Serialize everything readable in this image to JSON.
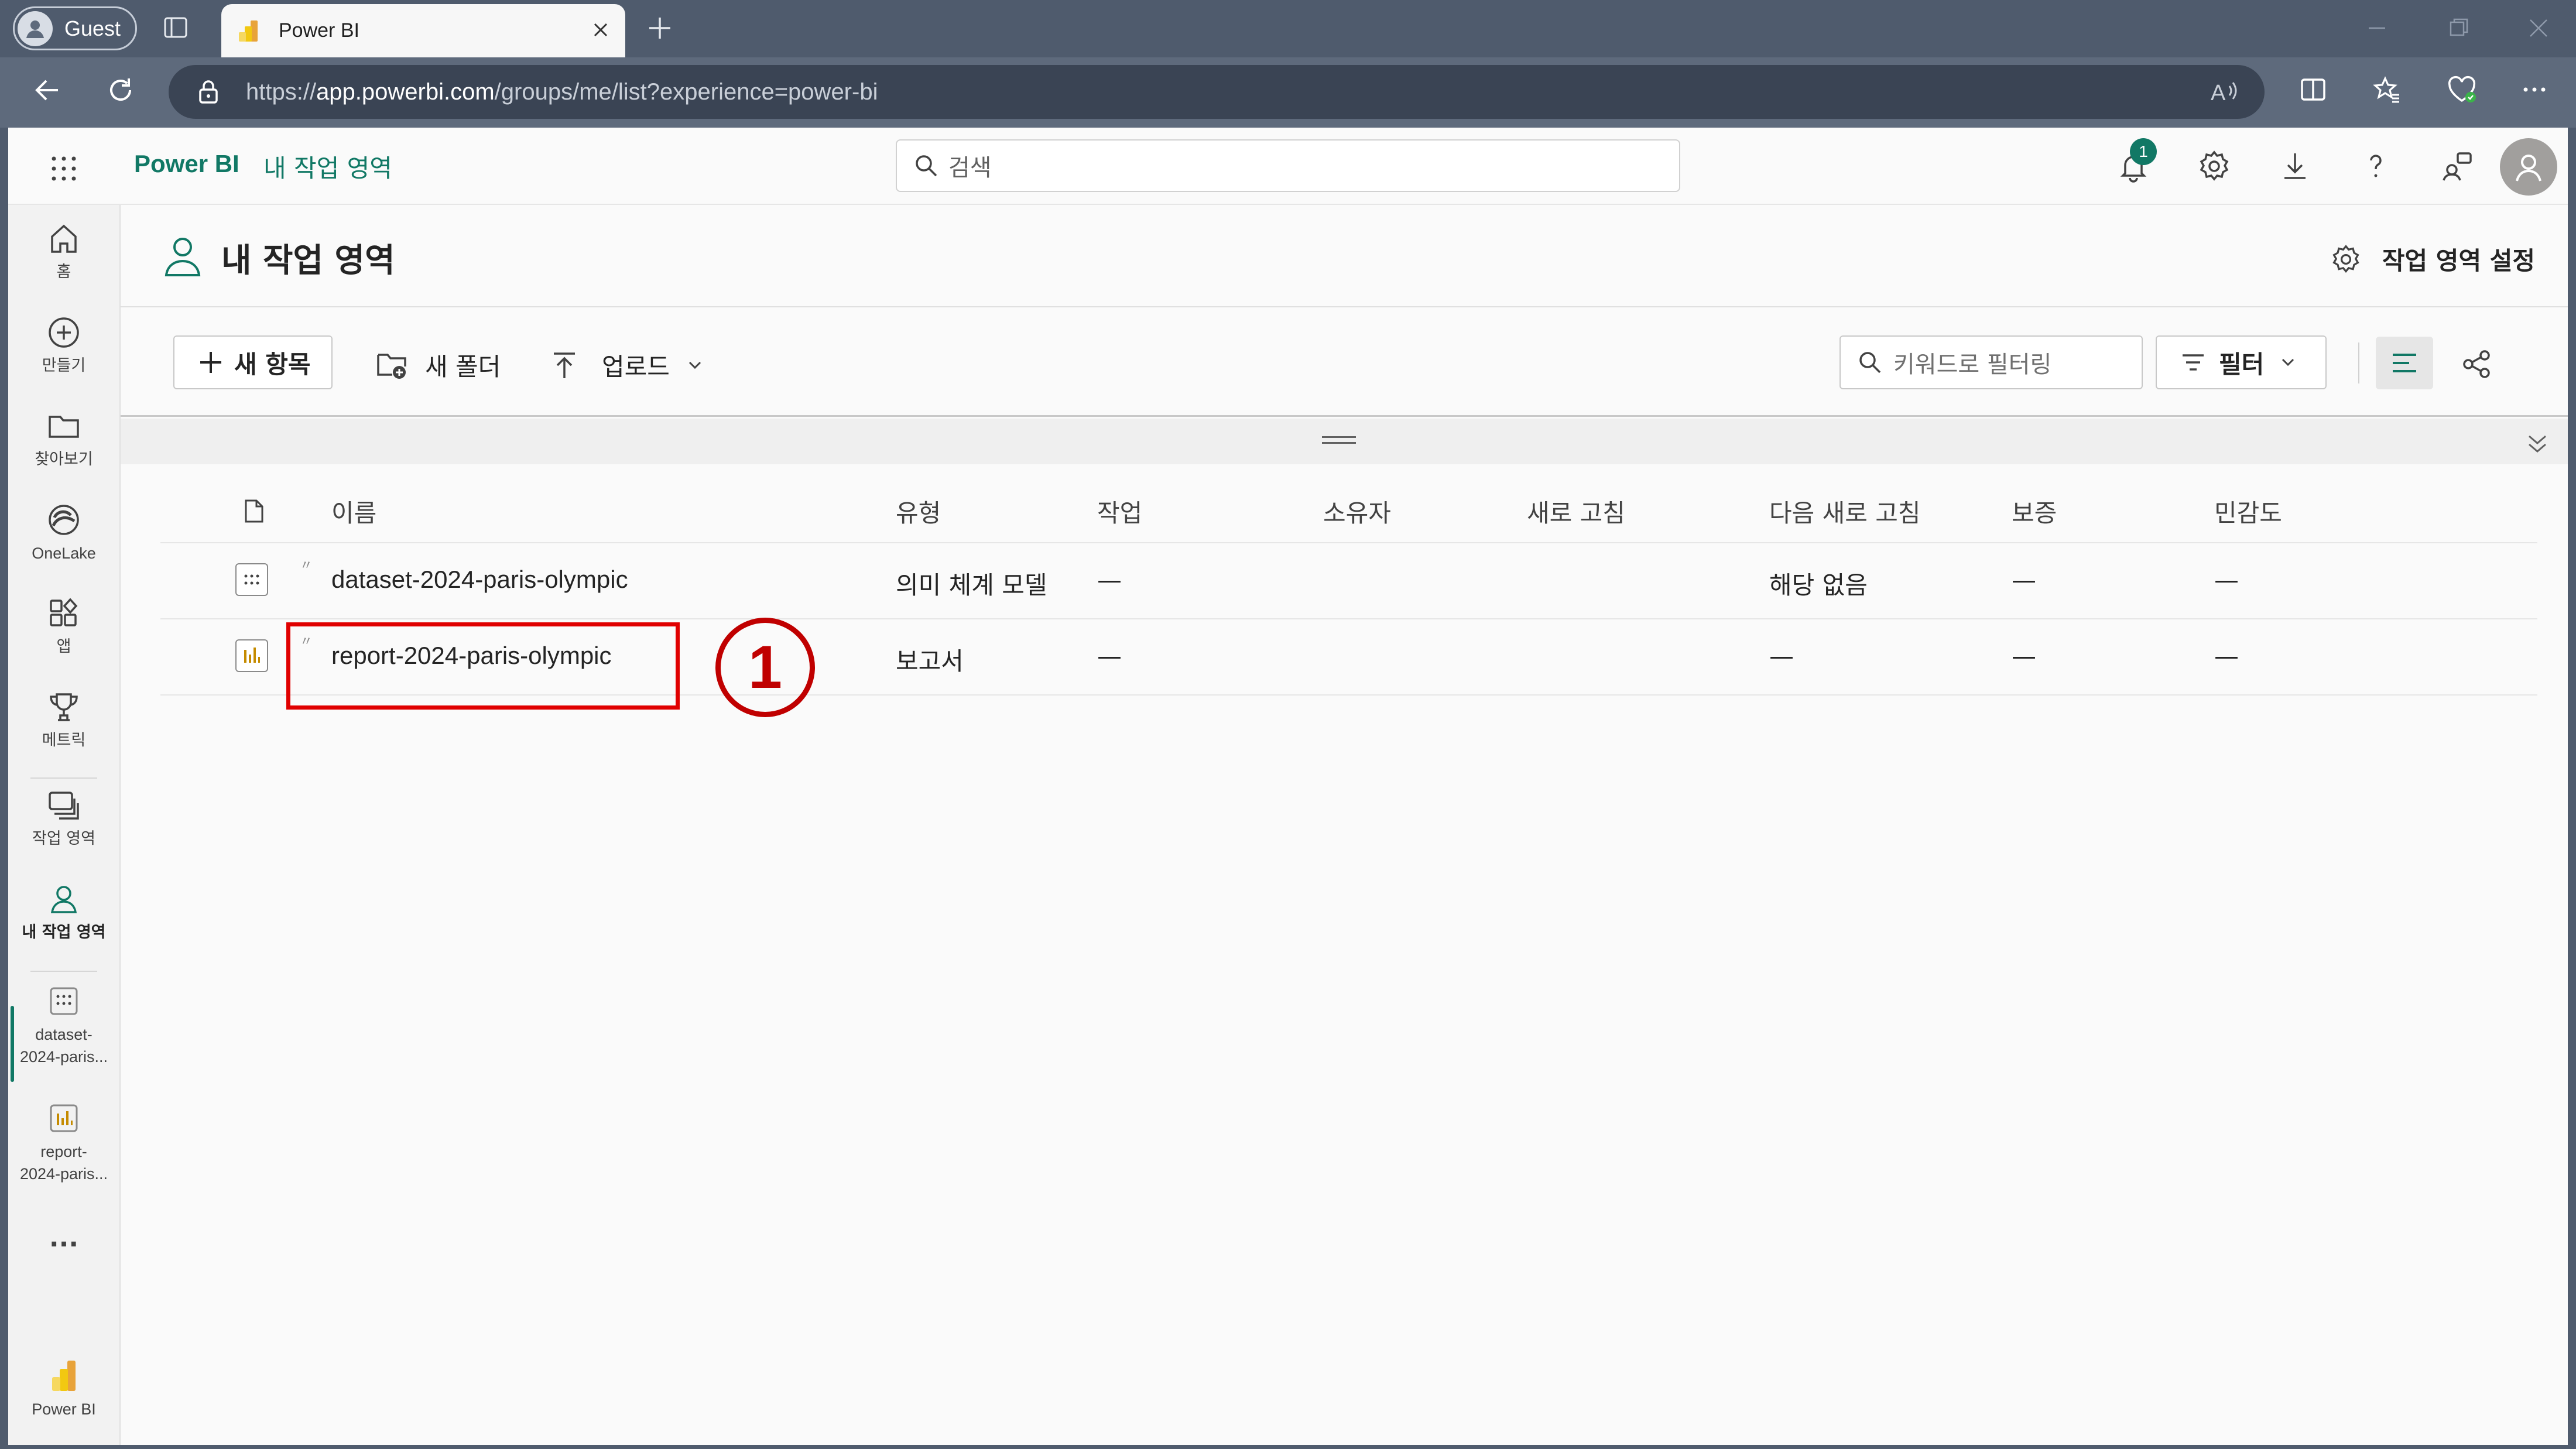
{
  "browser": {
    "profile_label": "Guest",
    "tab_title": "Power BI",
    "url_prefix": "https://",
    "url_host": "app.powerbi.com",
    "url_path": "/groups/me/list?experience=power-bi",
    "read_aloud": "A"
  },
  "app": {
    "brand": "Power BI",
    "breadcrumb": "내 작업 영역",
    "search_placeholder": "검색",
    "notification_count": "1"
  },
  "rail": {
    "home": "홈",
    "create": "만들기",
    "browse": "찾아보기",
    "onelake": "OneLake",
    "apps": "앱",
    "metrics": "메트릭",
    "workspaces": "작업 영역",
    "my_workspace": "내 작업 영역",
    "recent1": "dataset-\n2024-paris...",
    "recent1_a": "dataset-",
    "recent1_b": "2024-paris...",
    "recent2_a": "report-",
    "recent2_b": "2024-paris...",
    "more": "...",
    "powerbi": "Power BI"
  },
  "workspace": {
    "title": "내 작업 영역",
    "settings_label": "작업 영역 설정"
  },
  "toolbar": {
    "new_item": "새 항목",
    "new_folder": "새 폴더",
    "upload": "업로드",
    "keyword_filter_placeholder": "키워드로 필터링",
    "filter": "필터"
  },
  "table": {
    "columns": [
      "이름",
      "유형",
      "작업",
      "소유자",
      "새로 고침",
      "다음 새로 고침",
      "보증",
      "민감도"
    ],
    "rows": [
      {
        "name": "dataset-2024-paris-olympic",
        "type": "의미 체계 모델",
        "task": "—",
        "owner": "",
        "refreshed": "",
        "next_refresh": "해당 없음",
        "endorsement": "—",
        "sensitivity": "—"
      },
      {
        "name": "report-2024-paris-olympic",
        "type": "보고서",
        "task": "—",
        "owner": "",
        "refreshed": "",
        "next_refresh": "—",
        "endorsement": "—",
        "sensitivity": "—"
      }
    ]
  },
  "annotation": {
    "step_number": "1",
    "color": "#e00000"
  },
  "colors": {
    "accent": "#117865",
    "chrome": "#4f5b6d"
  }
}
